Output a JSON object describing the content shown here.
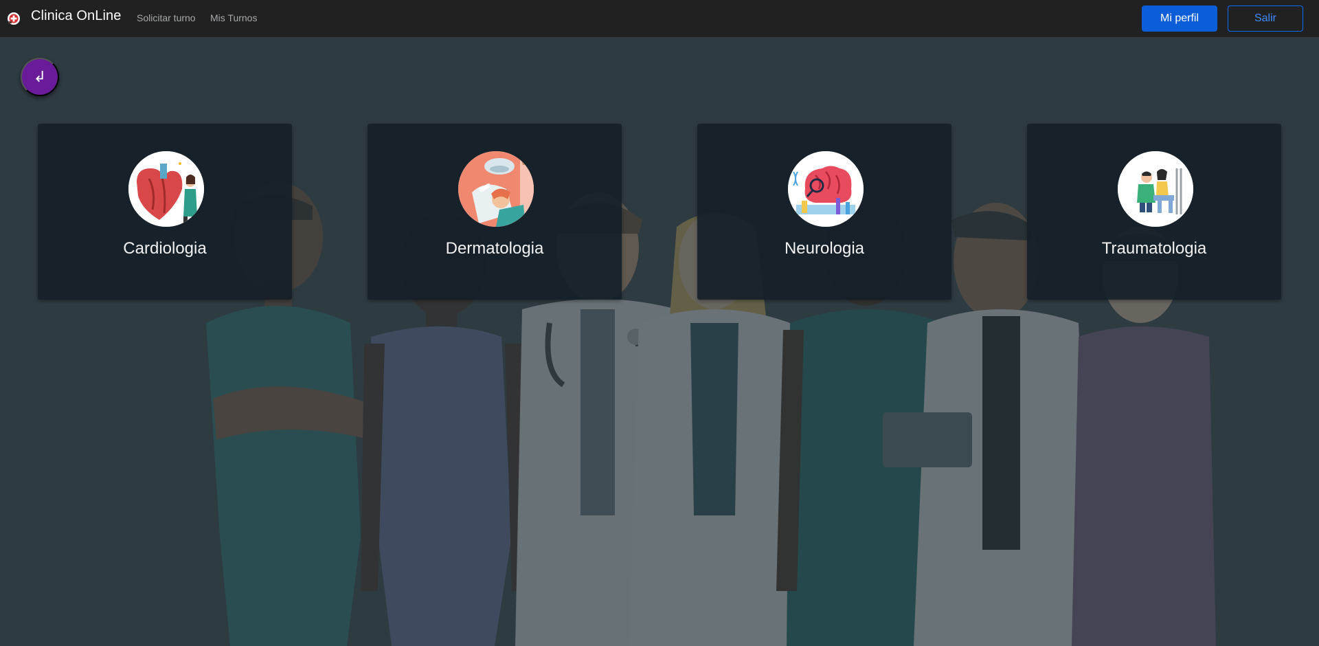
{
  "navbar": {
    "brand": "Clinica OnLine",
    "links": [
      "Solicitar turno",
      "Mis Turnos"
    ],
    "profile_button": "Mi perfil",
    "exit_button": "Salir"
  },
  "back_button": {
    "icon": "return-arrow-icon",
    "glyph": "↲",
    "color": "#6a1b9a"
  },
  "specialties": [
    {
      "name": "Cardiologia",
      "icon": "heart-illustration-icon"
    },
    {
      "name": "Dermatologia",
      "icon": "dermatology-illustration-icon"
    },
    {
      "name": "Neurologia",
      "icon": "brain-illustration-icon"
    },
    {
      "name": "Traumatologia",
      "icon": "traumatology-illustration-icon"
    }
  ],
  "colors": {
    "navbar": "#212121",
    "primary": "#0b5ed7",
    "card_bg": "#151f28",
    "back_button": "#6a1b9a"
  }
}
